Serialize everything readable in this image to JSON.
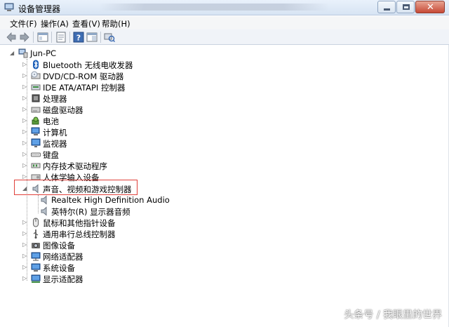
{
  "window": {
    "title": "设备管理器"
  },
  "menu": [
    "文件(F)",
    "操作(A)",
    "查看(V)",
    "帮助(H)"
  ],
  "toolbar": {
    "icons": [
      "back-arrow-icon",
      "forward-arrow-icon",
      "console-tree-icon",
      "properties-sheet-icon",
      "help-icon",
      "view-pane-icon",
      "scan-hardware-icon"
    ]
  },
  "tree": {
    "root": "Jun-PC",
    "items": [
      {
        "label": "Bluetooth 无线电收发器",
        "icon": "bluetooth-icon"
      },
      {
        "label": "DVD/CD-ROM 驱动器",
        "icon": "dvd-drive-icon"
      },
      {
        "label": "IDE ATA/ATAPI 控制器",
        "icon": "ide-controller-icon"
      },
      {
        "label": "处理器",
        "icon": "processor-icon"
      },
      {
        "label": "磁盘驱动器",
        "icon": "disk-drive-icon"
      },
      {
        "label": "电池",
        "icon": "battery-icon"
      },
      {
        "label": "计算机",
        "icon": "computer-icon"
      },
      {
        "label": "监视器",
        "icon": "monitor-icon"
      },
      {
        "label": "键盘",
        "icon": "keyboard-icon"
      },
      {
        "label": "内存技术驱动程序",
        "icon": "memory-icon"
      },
      {
        "label": "人体学输入设备",
        "icon": "hid-icon"
      },
      {
        "label": "声音、视频和游戏控制器",
        "icon": "speaker-icon"
      },
      {
        "label": "Realtek High Definition Audio",
        "icon": "speaker-icon"
      },
      {
        "label": "英特尔(R) 显示器音频",
        "icon": "speaker-icon"
      },
      {
        "label": "鼠标和其他指针设备",
        "icon": "mouse-icon"
      },
      {
        "label": "通用串行总线控制器",
        "icon": "usb-icon"
      },
      {
        "label": "图像设备",
        "icon": "camera-icon"
      },
      {
        "label": "网络适配器",
        "icon": "network-adapter-icon"
      },
      {
        "label": "系统设备",
        "icon": "system-device-icon"
      },
      {
        "label": "显示适配器",
        "icon": "display-adapter-icon"
      }
    ]
  },
  "watermark": "头条号 / 我眼里的世界"
}
